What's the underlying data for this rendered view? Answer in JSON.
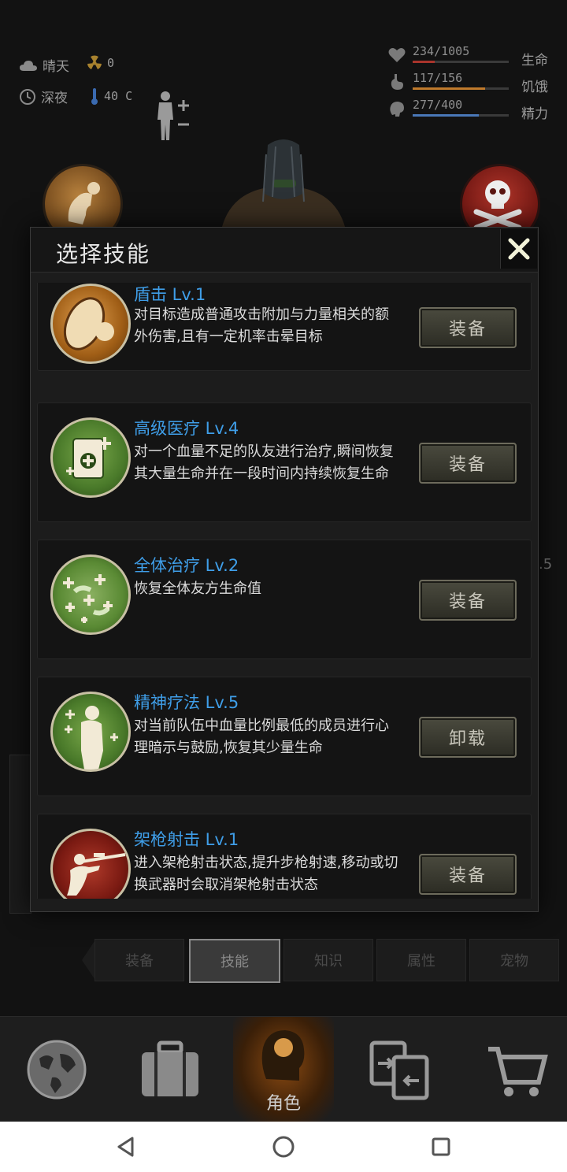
{
  "status": {
    "weather": "晴天",
    "radiation": "0",
    "time": "深夜",
    "temperature": "40 C",
    "bars": [
      {
        "label": "生命",
        "value": "234/1005",
        "fraction": 0.233,
        "color": "#a9342c",
        "icon": "heart-icon"
      },
      {
        "label": "饥饿",
        "value": "117/156",
        "fraction": 0.75,
        "color": "#c07a2c",
        "icon": "stomach-icon"
      },
      {
        "label": "精力",
        "value": "277/400",
        "fraction": 0.69,
        "color": "#4a78b8",
        "icon": "brain-icon"
      }
    ]
  },
  "background": {
    "side_number": ".5"
  },
  "dialog": {
    "title": "选择技能",
    "skills": [
      {
        "name": "盾击 Lv.1",
        "desc": "对目标造成普通攻击附加与力量相关的额外伤害,且有一定机率击晕目标",
        "button": "装备",
        "icon": "shield-bash-icon"
      },
      {
        "name": "高级医疗 Lv.4",
        "desc": "对一个血量不足的队友进行治疗,瞬间恢复其大量生命并在一段时间内持续恢复生命",
        "button": "装备",
        "icon": "medkit-icon"
      },
      {
        "name": "全体治疗 Lv.2",
        "desc": "恢复全体友方生命值",
        "button": "装备",
        "icon": "group-heal-icon"
      },
      {
        "name": "精神疗法 Lv.5",
        "desc": "对当前队伍中血量比例最低的成员进行心理暗示与鼓励,恢复其少量生命",
        "button": "卸载",
        "icon": "mental-therapy-icon"
      },
      {
        "name": "架枪射击 Lv.1",
        "desc": "进入架枪射击状态,提升步枪射速,移动或切换武器时会取消架枪射击状态",
        "button": "装备",
        "icon": "sniper-icon"
      }
    ]
  },
  "tabs": [
    "装备",
    "技能",
    "知识",
    "属性",
    "宠物"
  ],
  "active_tab": "技能",
  "nav": {
    "active_label": "角色"
  }
}
